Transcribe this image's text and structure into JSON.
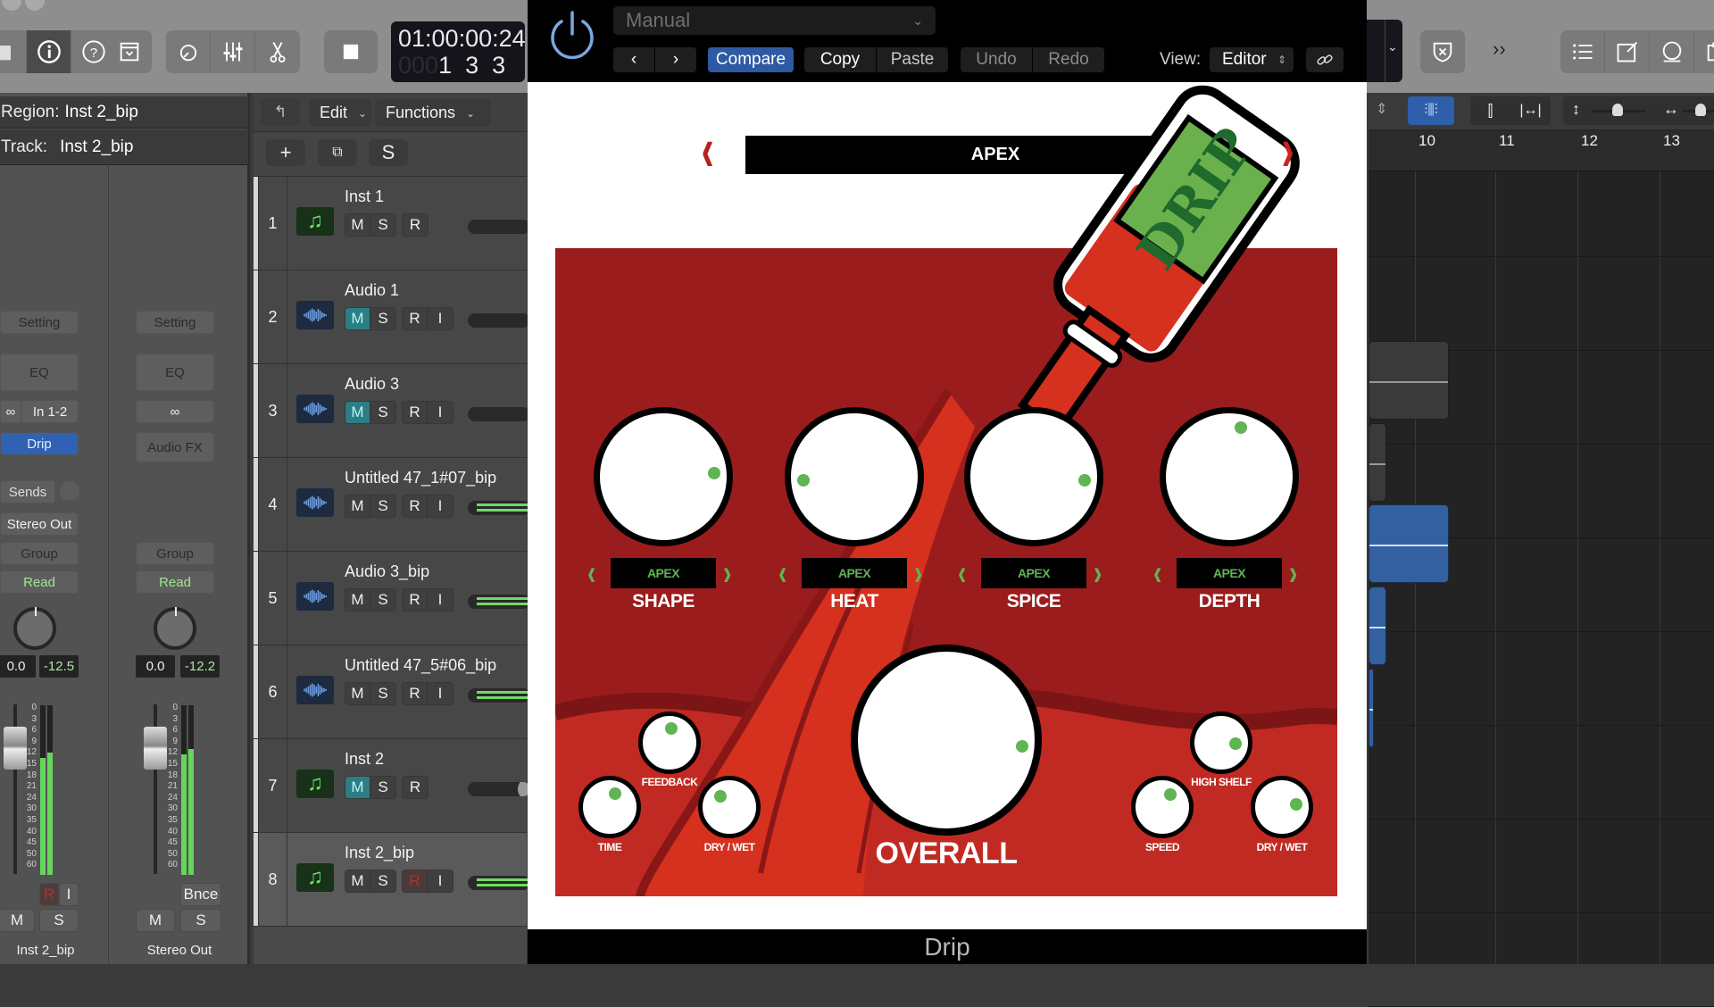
{
  "toolbar": {
    "icons": [
      "library-icon",
      "info-icon",
      "help-icon",
      "dropdown-icon",
      "metronome-icon",
      "mixer-icon",
      "scissors-icon",
      "stop-icon"
    ],
    "lcd_time": "01:00:00:24",
    "lcd_bars_dim": "000",
    "lcd_bars": "1  3  3",
    "right_icons": [
      "shield-close-icon",
      "more-icon",
      "list-icon",
      "notepad-icon",
      "loop-icon",
      "browser-icon"
    ]
  },
  "inspector": {
    "region_label": "Region:",
    "region_value": "Inst 2_bip",
    "track_label": "Track:",
    "track_value": "Inst 2_bip",
    "strip1": {
      "setting": "Setting",
      "eq": "EQ",
      "input": "In 1-2",
      "plugin": "Drip",
      "sends": "Sends",
      "output": "Stereo Out",
      "group": "Group",
      "automation": "Read",
      "volume": "0.0",
      "peak": "-12.5",
      "rec": "R",
      "input_mon": "I",
      "mute": "M",
      "solo": "S",
      "name": "Inst 2_bip",
      "meter_level": 0.72
    },
    "strip2": {
      "setting": "Setting",
      "eq": "EQ",
      "fx": "Audio FX",
      "group": "Group",
      "automation": "Read",
      "volume": "0.0",
      "peak": "-12.2",
      "bounce": "Bnce",
      "mute": "M",
      "solo": "S",
      "name": "Stereo Out",
      "meter_level": 0.74
    },
    "meter_scale": [
      "0",
      "3",
      "6",
      "9",
      "12",
      "15",
      "18",
      "21",
      "24",
      "30",
      "35",
      "40",
      "45",
      "50",
      "60"
    ]
  },
  "tracklist": {
    "edit_menu": "Edit",
    "functions_menu": "Functions",
    "add_label": "+",
    "solo_label": "S",
    "tracks": [
      {
        "num": "1",
        "name": "Inst 1",
        "type": "midi",
        "m": "M",
        "s": "S",
        "r": "R",
        "i": "",
        "muted": false
      },
      {
        "num": "2",
        "name": "Audio 1",
        "type": "audio",
        "m": "M",
        "s": "S",
        "r": "R",
        "i": "I",
        "muted": true
      },
      {
        "num": "3",
        "name": "Audio 3",
        "type": "audio",
        "m": "M",
        "s": "S",
        "r": "R",
        "i": "I",
        "muted": true
      },
      {
        "num": "4",
        "name": "Untitled 47_1#07_bip",
        "type": "audio",
        "m": "M",
        "s": "S",
        "r": "R",
        "i": "I",
        "muted": false
      },
      {
        "num": "5",
        "name": "Audio 3_bip",
        "type": "audio",
        "m": "M",
        "s": "S",
        "r": "R",
        "i": "I",
        "muted": false
      },
      {
        "num": "6",
        "name": "Untitled 47_5#06_bip",
        "type": "audio",
        "m": "M",
        "s": "S",
        "r": "R",
        "i": "I",
        "muted": false
      },
      {
        "num": "7",
        "name": "Inst 2",
        "type": "midi",
        "m": "M",
        "s": "S",
        "r": "R",
        "i": "",
        "muted": true
      },
      {
        "num": "8",
        "name": "Inst 2_bip",
        "type": "midi",
        "m": "M",
        "s": "S",
        "r": "R",
        "i": "I",
        "muted": false
      }
    ]
  },
  "plugin": {
    "preset": "Manual",
    "compare": "Compare",
    "copy": "Copy",
    "paste": "Paste",
    "undo": "Undo",
    "redo": "Redo",
    "view_label": "View:",
    "view_value": "Editor",
    "main_preset": "APEX",
    "logo_text": "DRIP",
    "footer": "Drip",
    "knobs": [
      {
        "label": "SHAPE",
        "preset": "APEX",
        "value": 0.82
      },
      {
        "label": "HEAT",
        "preset": "APEX",
        "value": 0.15
      },
      {
        "label": "SPICE",
        "preset": "APEX",
        "value": 0.85
      },
      {
        "label": "DEPTH",
        "preset": "APEX",
        "value": 0.55
      }
    ],
    "small_knobs": [
      {
        "label": "FEEDBACK",
        "value": 0.52
      },
      {
        "label": "TIME",
        "value": 0.58
      },
      {
        "label": "DRY / WET",
        "value": 0.35
      },
      {
        "label": "HIGH SHELF",
        "value": 0.85
      },
      {
        "label": "SPEED",
        "value": 0.62
      },
      {
        "label": "DRY / WET",
        "value": 0.8
      }
    ],
    "overall": {
      "label": "OVERALL",
      "value": 0.85
    }
  },
  "timeline": {
    "bars": [
      "10",
      "11",
      "12",
      "13"
    ]
  },
  "colors": {
    "plugin_red": "#9b1c1c",
    "knob_dot_green": "#5fb552",
    "logo_green": "#6ab14d",
    "accent_blue": "#2e5aa3",
    "mute_teal": "#2b7e86"
  }
}
